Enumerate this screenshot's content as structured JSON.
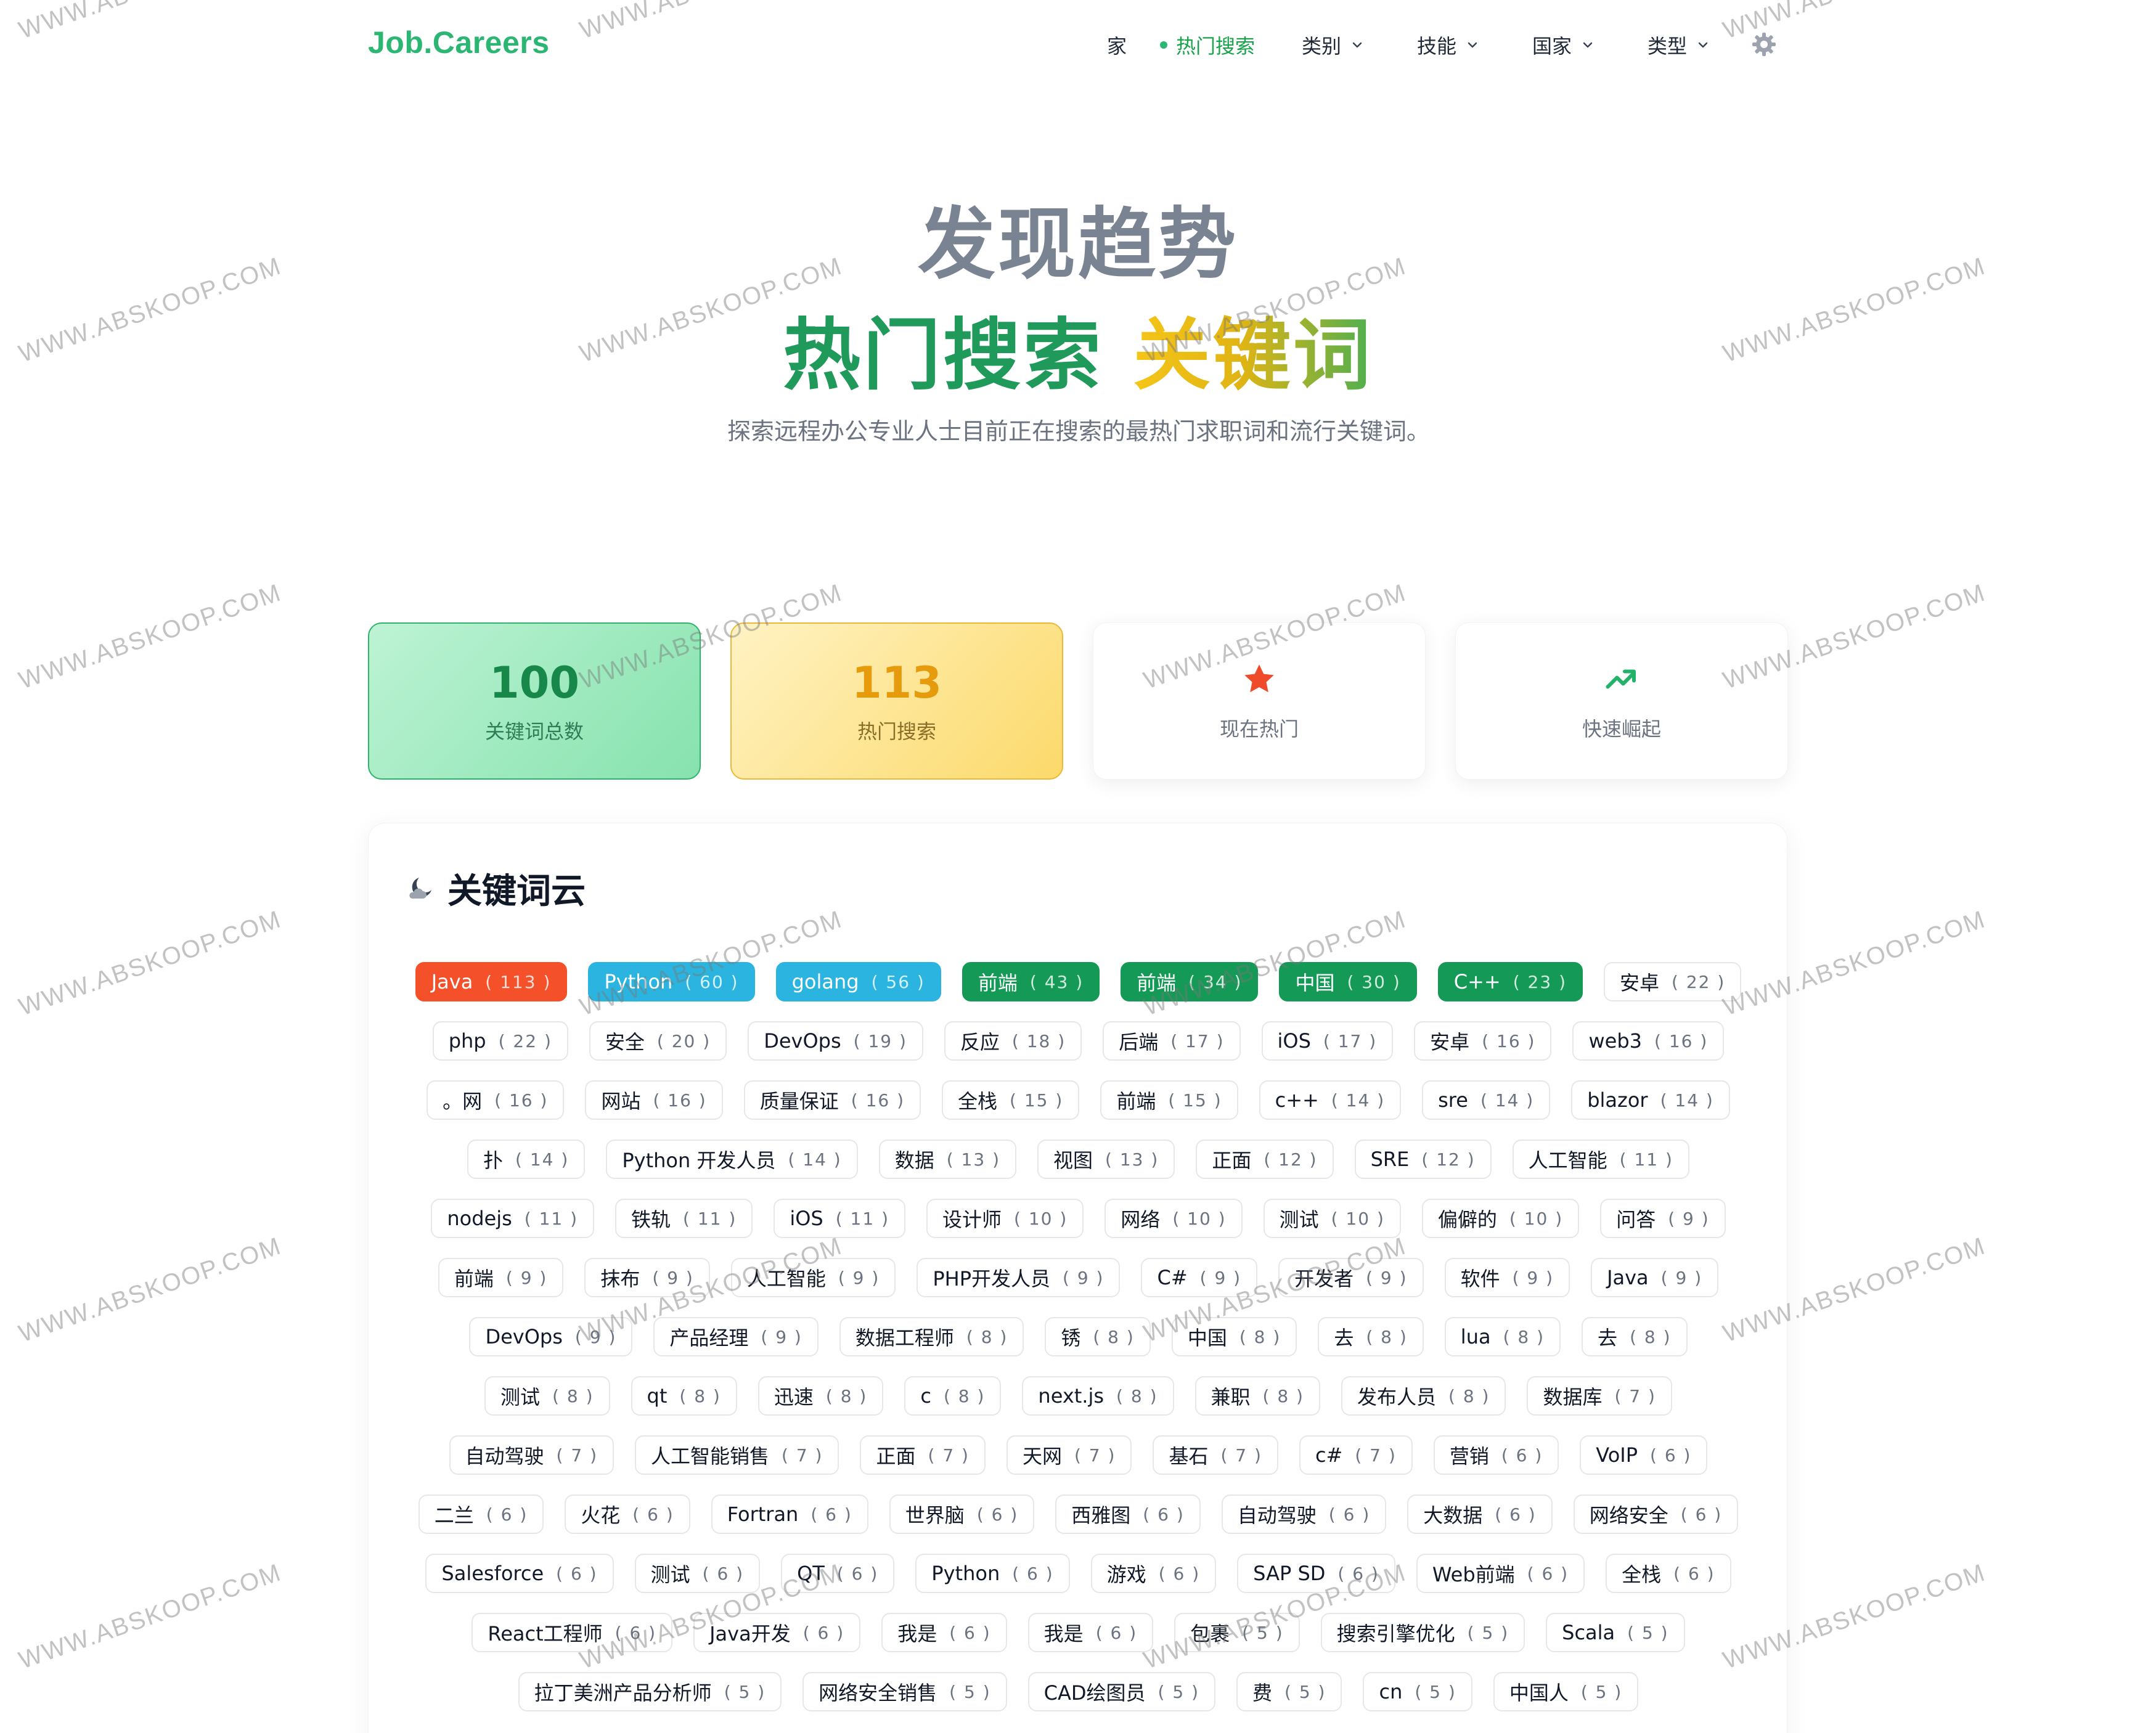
{
  "header": {
    "logo": "Job.Careers",
    "nav": [
      {
        "label": "家",
        "active": false,
        "has_dropdown": false
      },
      {
        "label": "热门搜索",
        "active": true,
        "has_dropdown": false
      },
      {
        "label": "类别",
        "active": false,
        "has_dropdown": true
      },
      {
        "label": "技能",
        "active": false,
        "has_dropdown": true
      },
      {
        "label": "国家",
        "active": false,
        "has_dropdown": true
      },
      {
        "label": "类型",
        "active": false,
        "has_dropdown": true
      }
    ],
    "settings_icon": "gear-icon"
  },
  "hero": {
    "title": "发现趋势",
    "subtitle_part1": "热门搜索",
    "subtitle_part2": "关键词",
    "description": "探索远程办公专业人士目前正在搜索的最热门求职词和流行关键词。"
  },
  "stats": [
    {
      "value": "100",
      "label": "关键词总数"
    },
    {
      "value": "113",
      "label": "热门搜索"
    },
    {
      "icon": "star-icon",
      "label": "现在热门"
    },
    {
      "icon": "trending-up-icon",
      "label": "快速崛起"
    }
  ],
  "cloud": {
    "title": "关键词云",
    "icon": "cloud-moon-icon",
    "keywords": [
      {
        "text": "Java",
        "count": "113",
        "style": "red"
      },
      {
        "text": "Python",
        "count": "60",
        "style": "blue"
      },
      {
        "text": "golang",
        "count": "56",
        "style": "blue"
      },
      {
        "text": "前端",
        "count": "43",
        "style": "dgreen"
      },
      {
        "text": "前端",
        "count": "34",
        "style": "dgreen"
      },
      {
        "text": "中国",
        "count": "30",
        "style": "dgreen"
      },
      {
        "text": "C++",
        "count": "23",
        "style": "dgreen"
      },
      {
        "text": "安卓",
        "count": "22",
        "style": "plain"
      },
      {
        "text": "php",
        "count": "22",
        "style": "plain"
      },
      {
        "text": "安全",
        "count": "20",
        "style": "plain"
      },
      {
        "text": "DevOps",
        "count": "19",
        "style": "plain"
      },
      {
        "text": "反应",
        "count": "18",
        "style": "plain"
      },
      {
        "text": "后端",
        "count": "17",
        "style": "plain"
      },
      {
        "text": "iOS",
        "count": "17",
        "style": "plain"
      },
      {
        "text": "安卓",
        "count": "16",
        "style": "plain"
      },
      {
        "text": "web3",
        "count": "16",
        "style": "plain"
      },
      {
        "text": "。网",
        "count": "16",
        "style": "plain"
      },
      {
        "text": "网站",
        "count": "16",
        "style": "plain"
      },
      {
        "text": "质量保证",
        "count": "16",
        "style": "plain"
      },
      {
        "text": "全栈",
        "count": "15",
        "style": "plain"
      },
      {
        "text": "前端",
        "count": "15",
        "style": "plain"
      },
      {
        "text": "c++",
        "count": "14",
        "style": "plain"
      },
      {
        "text": "sre",
        "count": "14",
        "style": "plain"
      },
      {
        "text": "blazor",
        "count": "14",
        "style": "plain"
      },
      {
        "text": "扑",
        "count": "14",
        "style": "plain"
      },
      {
        "text": "Python 开发人员",
        "count": "14",
        "style": "plain"
      },
      {
        "text": "数据",
        "count": "13",
        "style": "plain"
      },
      {
        "text": "视图",
        "count": "13",
        "style": "plain"
      },
      {
        "text": "正面",
        "count": "12",
        "style": "plain"
      },
      {
        "text": "SRE",
        "count": "12",
        "style": "plain"
      },
      {
        "text": "人工智能",
        "count": "11",
        "style": "plain"
      },
      {
        "text": "nodejs",
        "count": "11",
        "style": "plain"
      },
      {
        "text": "铁轨",
        "count": "11",
        "style": "plain"
      },
      {
        "text": "iOS",
        "count": "11",
        "style": "plain"
      },
      {
        "text": "设计师",
        "count": "10",
        "style": "plain"
      },
      {
        "text": "网络",
        "count": "10",
        "style": "plain"
      },
      {
        "text": "测试",
        "count": "10",
        "style": "plain"
      },
      {
        "text": "偏僻的",
        "count": "10",
        "style": "plain"
      },
      {
        "text": "问答",
        "count": "9",
        "style": "plain"
      },
      {
        "text": "前端",
        "count": "9",
        "style": "plain"
      },
      {
        "text": "抹布",
        "count": "9",
        "style": "plain"
      },
      {
        "text": "人工智能",
        "count": "9",
        "style": "plain"
      },
      {
        "text": "PHP开发人员",
        "count": "9",
        "style": "plain"
      },
      {
        "text": "C#",
        "count": "9",
        "style": "plain"
      },
      {
        "text": "开发者",
        "count": "9",
        "style": "plain"
      },
      {
        "text": "软件",
        "count": "9",
        "style": "plain"
      },
      {
        "text": "Java",
        "count": "9",
        "style": "plain"
      },
      {
        "text": "DevOps",
        "count": "9",
        "style": "plain"
      },
      {
        "text": "产品经理",
        "count": "9",
        "style": "plain"
      },
      {
        "text": "数据工程师",
        "count": "8",
        "style": "plain"
      },
      {
        "text": "锈",
        "count": "8",
        "style": "plain"
      },
      {
        "text": "中国",
        "count": "8",
        "style": "plain"
      },
      {
        "text": "去",
        "count": "8",
        "style": "plain"
      },
      {
        "text": "lua",
        "count": "8",
        "style": "plain"
      },
      {
        "text": "去",
        "count": "8",
        "style": "plain"
      },
      {
        "text": "测试",
        "count": "8",
        "style": "plain"
      },
      {
        "text": "qt",
        "count": "8",
        "style": "plain"
      },
      {
        "text": "迅速",
        "count": "8",
        "style": "plain"
      },
      {
        "text": "c",
        "count": "8",
        "style": "plain"
      },
      {
        "text": "next.js",
        "count": "8",
        "style": "plain"
      },
      {
        "text": "兼职",
        "count": "8",
        "style": "plain"
      },
      {
        "text": "发布人员",
        "count": "8",
        "style": "plain"
      },
      {
        "text": "数据库",
        "count": "7",
        "style": "plain"
      },
      {
        "text": "自动驾驶",
        "count": "7",
        "style": "plain"
      },
      {
        "text": "人工智能销售",
        "count": "7",
        "style": "plain"
      },
      {
        "text": "正面",
        "count": "7",
        "style": "plain"
      },
      {
        "text": "天网",
        "count": "7",
        "style": "plain"
      },
      {
        "text": "基石",
        "count": "7",
        "style": "plain"
      },
      {
        "text": "c#",
        "count": "7",
        "style": "plain"
      },
      {
        "text": "营销",
        "count": "6",
        "style": "plain"
      },
      {
        "text": "VoIP",
        "count": "6",
        "style": "plain"
      },
      {
        "text": "二兰",
        "count": "6",
        "style": "plain"
      },
      {
        "text": "火花",
        "count": "6",
        "style": "plain"
      },
      {
        "text": "Fortran",
        "count": "6",
        "style": "plain"
      },
      {
        "text": "世界脑",
        "count": "6",
        "style": "plain"
      },
      {
        "text": "西雅图",
        "count": "6",
        "style": "plain"
      },
      {
        "text": "自动驾驶",
        "count": "6",
        "style": "plain"
      },
      {
        "text": "大数据",
        "count": "6",
        "style": "plain"
      },
      {
        "text": "网络安全",
        "count": "6",
        "style": "plain"
      },
      {
        "text": "Salesforce",
        "count": "6",
        "style": "plain"
      },
      {
        "text": "测试",
        "count": "6",
        "style": "plain"
      },
      {
        "text": "QT",
        "count": "6",
        "style": "plain"
      },
      {
        "text": "Python",
        "count": "6",
        "style": "plain"
      },
      {
        "text": "游戏",
        "count": "6",
        "style": "plain"
      },
      {
        "text": "SAP SD",
        "count": "6",
        "style": "plain"
      },
      {
        "text": "Web前端",
        "count": "6",
        "style": "plain"
      },
      {
        "text": "全栈",
        "count": "6",
        "style": "plain"
      },
      {
        "text": "React工程师",
        "count": "6",
        "style": "plain"
      },
      {
        "text": "Java开发",
        "count": "6",
        "style": "plain"
      },
      {
        "text": "我是",
        "count": "6",
        "style": "plain"
      },
      {
        "text": "我是",
        "count": "6",
        "style": "plain"
      },
      {
        "text": "包裹",
        "count": "5",
        "style": "plain"
      },
      {
        "text": "搜索引擎优化",
        "count": "5",
        "style": "plain"
      },
      {
        "text": "Scala",
        "count": "5",
        "style": "plain"
      },
      {
        "text": "拉丁美洲产品分析师",
        "count": "5",
        "style": "plain"
      },
      {
        "text": "网络安全销售",
        "count": "5",
        "style": "plain"
      },
      {
        "text": "CAD绘图员",
        "count": "5",
        "style": "plain"
      },
      {
        "text": "费",
        "count": "5",
        "style": "plain"
      },
      {
        "text": "cn",
        "count": "5",
        "style": "plain"
      },
      {
        "text": "中国人",
        "count": "5",
        "style": "plain"
      }
    ]
  },
  "watermark": "WWW.ABSKOOP.COM",
  "colors": {
    "brand": "#2bb673",
    "accent_yellow": "#f5c518",
    "tag_red": "#f4502a",
    "tag_blue": "#2ab4df",
    "tag_green": "#149a56"
  }
}
